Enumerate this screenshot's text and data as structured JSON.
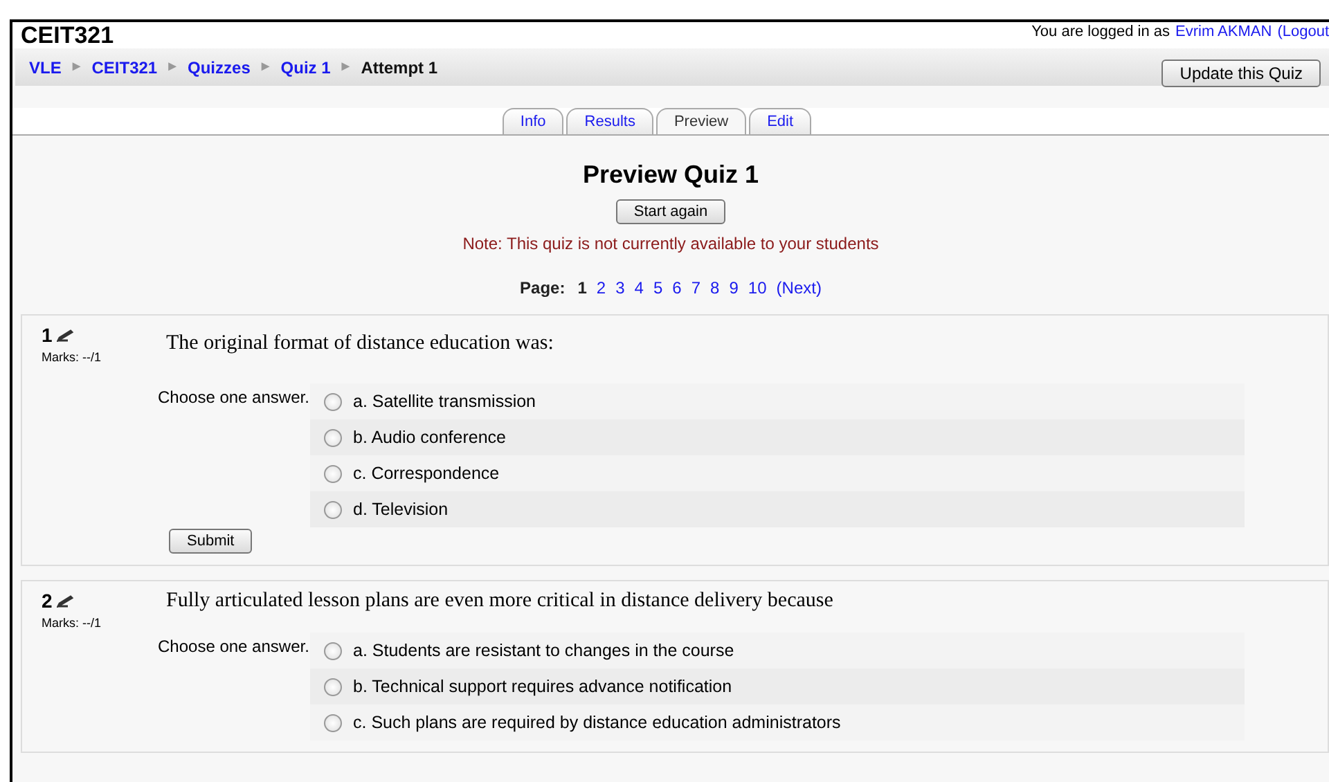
{
  "header": {
    "course": "CEIT321",
    "login_prefix": "You are logged in as",
    "user": "Evrim AKMAN",
    "logout": "(Logout"
  },
  "breadcrumb": {
    "links": [
      "VLE",
      "CEIT321",
      "Quizzes",
      "Quiz 1"
    ],
    "separator": "►",
    "current": "Attempt 1"
  },
  "update_button": "Update this Quiz",
  "tabs": [
    {
      "label": "Info",
      "selected": false
    },
    {
      "label": "Results",
      "selected": false
    },
    {
      "label": "Preview",
      "selected": true
    },
    {
      "label": "Edit",
      "selected": false
    }
  ],
  "title": "Preview Quiz 1",
  "start_again": "Start again",
  "note": "Note: This quiz is not currently available to your students",
  "pager": {
    "label": "Page:",
    "pages": [
      {
        "label": "1",
        "selected": true
      },
      {
        "label": "2",
        "selected": false
      },
      {
        "label": "3",
        "selected": false
      },
      {
        "label": "4",
        "selected": false
      },
      {
        "label": "5",
        "selected": false
      },
      {
        "label": "6",
        "selected": false
      },
      {
        "label": "7",
        "selected": false
      },
      {
        "label": "8",
        "selected": false
      },
      {
        "label": "9",
        "selected": false
      },
      {
        "label": "10",
        "selected": false
      }
    ],
    "next": "(Next)"
  },
  "questions": [
    {
      "number": "1",
      "marks": "Marks: --/1",
      "text": "The original format of distance education was:",
      "prompt": "Choose one answer.",
      "options": [
        {
          "label": "a. Satellite transmission",
          "checked": false
        },
        {
          "label": "b. Audio conference",
          "checked": false
        },
        {
          "label": "c. Correspondence",
          "checked": false
        },
        {
          "label": "d. Television",
          "checked": false
        }
      ],
      "submit": "Submit"
    },
    {
      "number": "2",
      "marks": "Marks: --/1",
      "text": "Fully articulated lesson plans are even more critical in distance delivery because",
      "prompt": "Choose one answer.",
      "options": [
        {
          "label": "a. Students are resistant to changes in the course",
          "checked": false
        },
        {
          "label": "b. Technical support requires advance notification",
          "checked": false
        },
        {
          "label": "c. Such plans are required by distance education administrators",
          "checked": false
        }
      ]
    }
  ]
}
